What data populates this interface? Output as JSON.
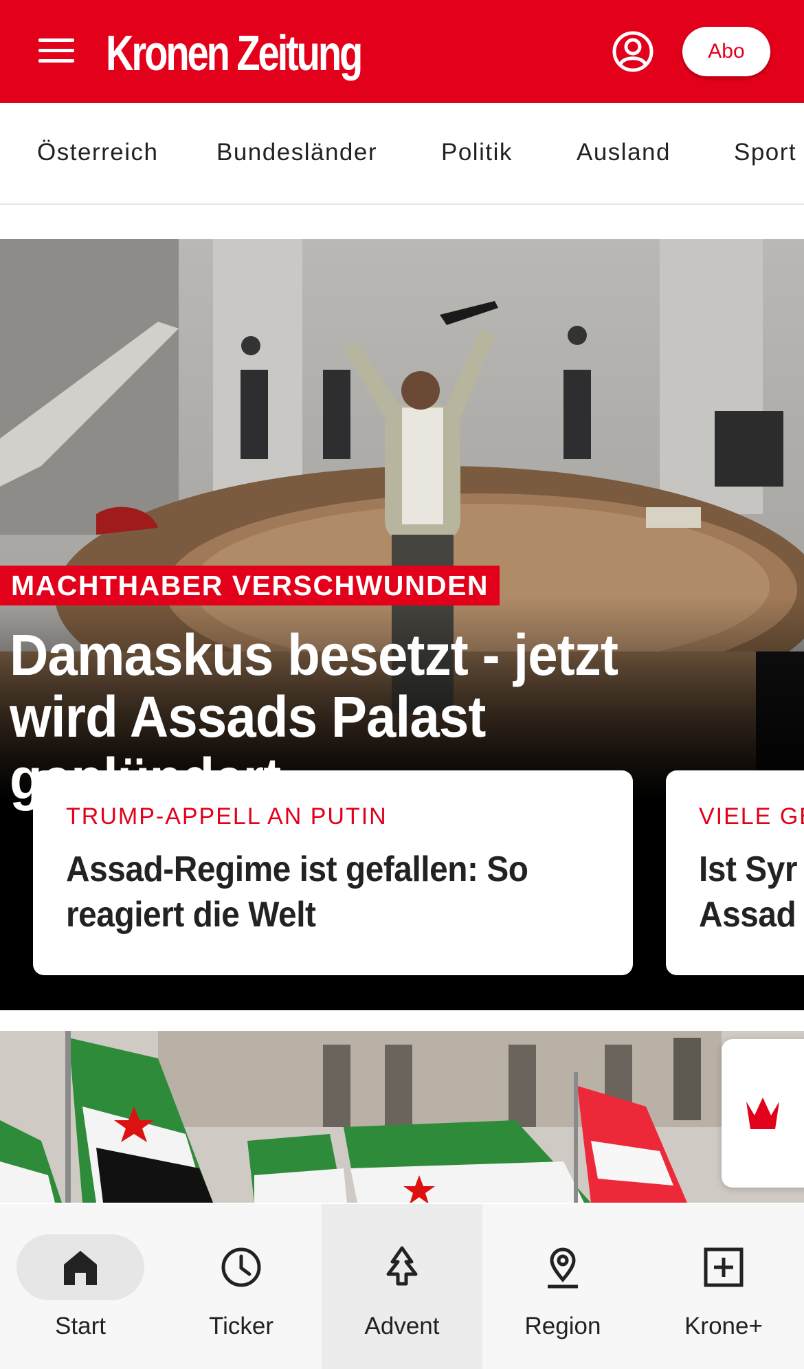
{
  "header": {
    "logo": "Kronen Zeitung",
    "menu_icon": "hamburger-menu-icon",
    "account_icon": "user-account-icon",
    "abo_label": "Abo",
    "brand_color": "#e2001a"
  },
  "nav": {
    "items": [
      {
        "label": "Österreich"
      },
      {
        "label": "Bundesländer"
      },
      {
        "label": "Politik"
      },
      {
        "label": "Ausland"
      },
      {
        "label": "Sport"
      }
    ]
  },
  "hero": {
    "overline": "MACHTHABER VERSCHWUNDEN",
    "title": "Damaskus besetzt - jetzt wird Assads Palast geplündert",
    "cards": [
      {
        "overline": "TRUMP-APPELL AN PUTIN",
        "title_line1": "Assad-Regime ist gefallen: So",
        "title_line2": "reagiert die Welt"
      },
      {
        "overline": "VIELE GE",
        "title_line1": "Ist Syr",
        "title_line2": "Assad"
      }
    ]
  },
  "floating": {
    "icon": "krone-crown-icon"
  },
  "bottom_nav": {
    "tabs": [
      {
        "label": "Start",
        "icon": "home-icon",
        "selected": true
      },
      {
        "label": "Ticker",
        "icon": "clock-icon"
      },
      {
        "label": "Advent",
        "icon": "christmas-tree-icon"
      },
      {
        "label": "Region",
        "icon": "location-pin-icon"
      },
      {
        "label": "Krone+",
        "icon": "plus-box-icon"
      }
    ]
  }
}
